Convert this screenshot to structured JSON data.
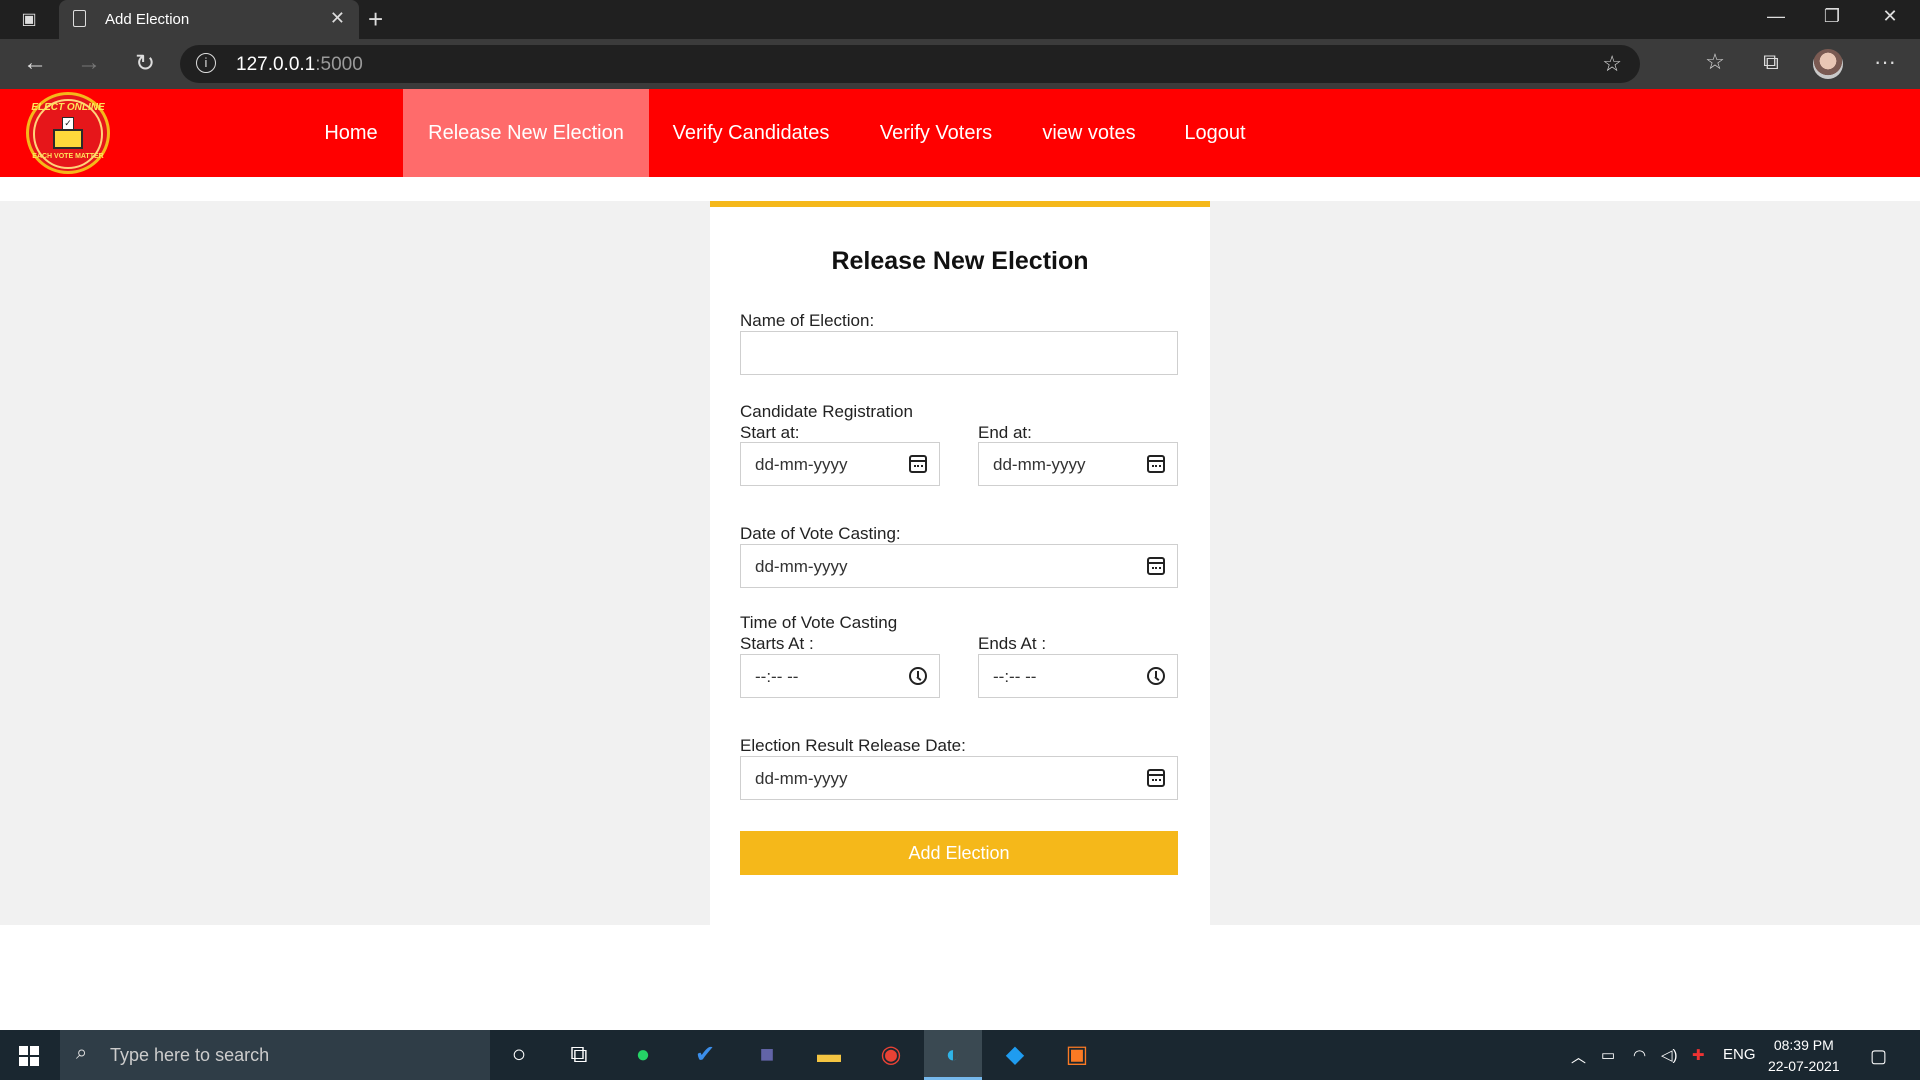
{
  "browser": {
    "tab_title": "Add Election",
    "url_host": "127.0.0.1",
    "url_port": ":5000"
  },
  "site": {
    "logo_text_top": "ELECT ONLINE",
    "logo_text_bottom": "EACH VOTE MATTER",
    "nav": [
      {
        "label": "Home",
        "active": false
      },
      {
        "label": "Release New Election",
        "active": true
      },
      {
        "label": "Verify Candidates",
        "active": false
      },
      {
        "label": "Verify Voters",
        "active": false
      },
      {
        "label": "view votes",
        "active": false
      },
      {
        "label": "Logout",
        "active": false
      }
    ],
    "accent_color": "#ff0000",
    "active_nav_color": "#ff6b6b",
    "card_accent_color": "#f5b81a"
  },
  "form": {
    "title": "Release New Election",
    "name_label": "Name of Election:",
    "name_value": "",
    "cand_reg_label": "Candidate Registration",
    "start_label": "Start at:",
    "end_label": "End at:",
    "cand_start_value": "dd-mm-yyyy",
    "cand_end_value": "dd-mm-yyyy",
    "vote_date_label": "Date of Vote Casting:",
    "vote_date_value": "dd-mm-yyyy",
    "vote_time_label": "Time of Vote Casting",
    "starts_at_label": "Starts At :",
    "ends_at_label": "Ends At :",
    "time_start_value": "--:-- --",
    "time_end_value": "--:-- --",
    "result_date_label": "Election Result Release Date:",
    "result_date_value": "dd-mm-yyyy",
    "submit_label": "Add Election"
  },
  "taskbar": {
    "search_placeholder": "Type here to search",
    "language": "ENG",
    "time": "08:39 PM",
    "date": "22-07-2021"
  }
}
